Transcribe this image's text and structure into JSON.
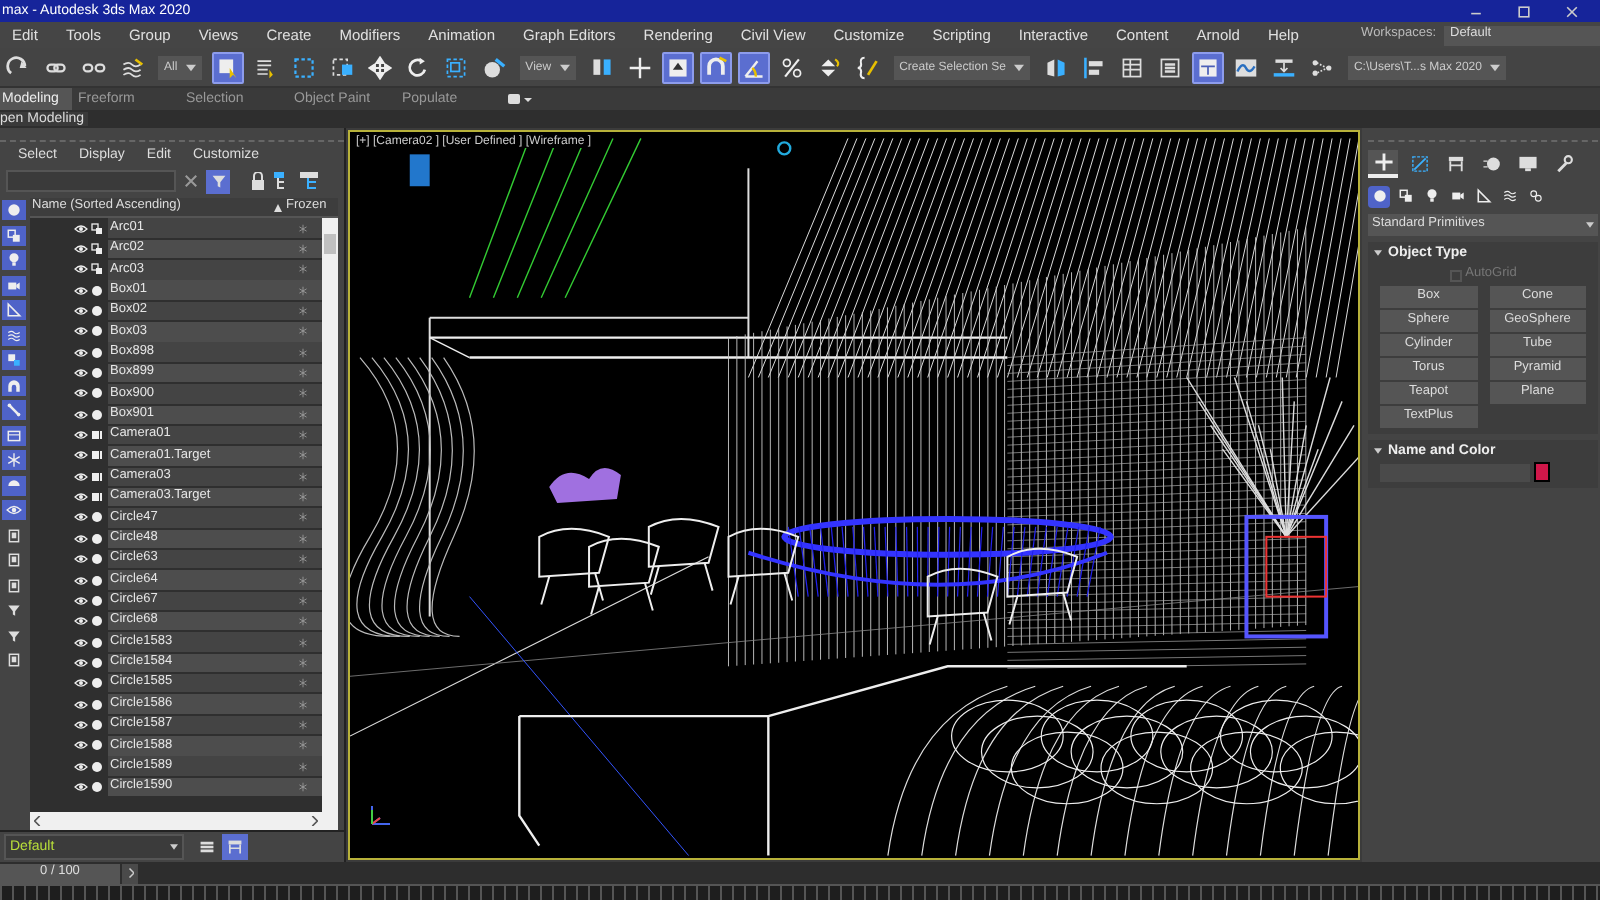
{
  "title_bar": {
    "title": "max - Autodesk 3ds Max 2020"
  },
  "menu_bar": {
    "items": [
      "Edit",
      "Tools",
      "Group",
      "Views",
      "Create",
      "Modifiers",
      "Animation",
      "Graph Editors",
      "Rendering",
      "Civil View",
      "Customize",
      "Scripting",
      "Interactive",
      "Content",
      "Arnold",
      "Help"
    ],
    "workspaces_label": "Workspaces:",
    "workspace": "Default"
  },
  "main_toolbar": {
    "items": [
      {
        "kind": "redo",
        "selected": false
      },
      {
        "kind": "link",
        "selected": false
      },
      {
        "kind": "unlink",
        "selected": false
      },
      {
        "kind": "bind",
        "selected": false
      },
      {
        "kind": "dropdown",
        "value": "All"
      },
      {
        "kind": "cursor",
        "selected": true
      },
      {
        "kind": "list",
        "selected": false
      },
      {
        "kind": "region",
        "selected": false
      },
      {
        "kind": "crossing",
        "selected": false
      },
      {
        "kind": "move",
        "selected": false
      },
      {
        "kind": "rotate",
        "selected": false
      },
      {
        "kind": "scale",
        "selected": false
      },
      {
        "kind": "placement",
        "selected": false
      },
      {
        "kind": "dropdown",
        "value": "View"
      },
      {
        "kind": "pivot",
        "selected": false
      },
      {
        "kind": "crosshair",
        "selected": false
      },
      {
        "kind": "keyboard",
        "selected": true
      },
      {
        "kind": "snap",
        "selected": true
      },
      {
        "kind": "angle",
        "selected": true
      },
      {
        "kind": "percent",
        "selected": false
      },
      {
        "kind": "spinner",
        "selected": false
      },
      {
        "kind": "braces",
        "selected": false
      },
      {
        "kind": "dropdown",
        "value": "Create Selection Se"
      },
      {
        "kind": "mirror",
        "selected": false
      },
      {
        "kind": "align",
        "selected": false
      },
      {
        "kind": "table",
        "selected": false
      },
      {
        "kind": "layers",
        "selected": false
      },
      {
        "kind": "ribbon",
        "selected": true
      },
      {
        "kind": "curve",
        "selected": false
      },
      {
        "kind": "schematic",
        "selected": false
      },
      {
        "kind": "nodes",
        "selected": false
      },
      {
        "kind": "dropdown",
        "value": "C:\\Users\\T...s Max 2020"
      }
    ]
  },
  "ribbon": {
    "tabs": [
      {
        "label": "Modeling",
        "selected": true
      },
      {
        "label": "Freeform",
        "selected": false
      },
      {
        "label": "Selection",
        "selected": false
      },
      {
        "label": "Object Paint",
        "selected": false
      },
      {
        "label": "Populate",
        "selected": false
      }
    ],
    "panel_label": "pen Modeling"
  },
  "scene_explorer": {
    "menu": [
      "Select",
      "Display",
      "Edit",
      "Customize"
    ],
    "filters": [
      {
        "kind": "geometry",
        "selected": true
      },
      {
        "kind": "shapes",
        "selected": true
      },
      {
        "kind": "lights",
        "selected": true
      },
      {
        "kind": "cameras",
        "selected": true
      },
      {
        "kind": "helpers",
        "selected": true
      },
      {
        "kind": "spacewarps",
        "selected": true
      },
      {
        "kind": "groups",
        "selected": true
      },
      {
        "kind": "xrefs",
        "selected": true
      },
      {
        "kind": "bones",
        "selected": true
      },
      {
        "kind": "containers",
        "selected": true
      },
      {
        "kind": "frozen",
        "selected": true
      },
      {
        "kind": "hidden",
        "selected": true
      },
      {
        "kind": "visible",
        "selected": true
      },
      {
        "kind": "page",
        "selected": false
      },
      {
        "kind": "page",
        "selected": false
      },
      {
        "kind": "page",
        "selected": false
      },
      {
        "kind": "filter",
        "selected": false
      },
      {
        "kind": "filter",
        "selected": false
      },
      {
        "kind": "page",
        "selected": false
      }
    ],
    "columns": [
      "Name (Sorted Ascending)",
      "Frozen"
    ],
    "rows": [
      {
        "name": "Arc01",
        "kind": "shape"
      },
      {
        "name": "Arc02",
        "kind": "shape"
      },
      {
        "name": "Arc03",
        "kind": "shape"
      },
      {
        "name": "Box01",
        "kind": "geometry"
      },
      {
        "name": "Box02",
        "kind": "geometry"
      },
      {
        "name": "Box03",
        "kind": "geometry"
      },
      {
        "name": "Box898",
        "kind": "geometry"
      },
      {
        "name": "Box899",
        "kind": "geometry"
      },
      {
        "name": "Box900",
        "kind": "geometry"
      },
      {
        "name": "Box901",
        "kind": "geometry"
      },
      {
        "name": "Camera01",
        "kind": "camera"
      },
      {
        "name": "Camera01.Target",
        "kind": "camera"
      },
      {
        "name": "Camera03",
        "kind": "camera"
      },
      {
        "name": "Camera03.Target",
        "kind": "camera"
      },
      {
        "name": "Circle47",
        "kind": "geometry"
      },
      {
        "name": "Circle48",
        "kind": "geometry"
      },
      {
        "name": "Circle63",
        "kind": "geometry"
      },
      {
        "name": "Circle64",
        "kind": "geometry"
      },
      {
        "name": "Circle67",
        "kind": "geometry"
      },
      {
        "name": "Circle68",
        "kind": "geometry"
      },
      {
        "name": "Circle1583",
        "kind": "geometry"
      },
      {
        "name": "Circle1584",
        "kind": "geometry"
      },
      {
        "name": "Circle1585",
        "kind": "geometry"
      },
      {
        "name": "Circle1586",
        "kind": "geometry"
      },
      {
        "name": "Circle1587",
        "kind": "geometry"
      },
      {
        "name": "Circle1588",
        "kind": "geometry"
      },
      {
        "name": "Circle1589",
        "kind": "geometry"
      },
      {
        "name": "Circle1590",
        "kind": "geometry"
      }
    ],
    "layer": "Default"
  },
  "viewport": {
    "label": "[+] [Camera02 ] [User Defined ] [Wireframe ]"
  },
  "command_panel": {
    "tabs": [
      {
        "kind": "create",
        "selected": true
      },
      {
        "kind": "modify",
        "selected": false
      },
      {
        "kind": "hierarchy",
        "selected": false
      },
      {
        "kind": "motion",
        "selected": false
      },
      {
        "kind": "display",
        "selected": false
      },
      {
        "kind": "utilities",
        "selected": false
      }
    ],
    "categories": [
      {
        "kind": "geometry",
        "selected": true
      },
      {
        "kind": "shapes",
        "selected": false
      },
      {
        "kind": "lights",
        "selected": false
      },
      {
        "kind": "cameras",
        "selected": false
      },
      {
        "kind": "helpers",
        "selected": false
      },
      {
        "kind": "spacewarps",
        "selected": false
      },
      {
        "kind": "systems",
        "selected": false
      }
    ],
    "category": "Standard Primitives",
    "object_type": {
      "title": "Object Type",
      "autogrid": {
        "label": "AutoGrid",
        "checked": false,
        "disabled": true
      },
      "buttons": [
        "Box",
        "Cone",
        "Sphere",
        "GeoSphere",
        "Cylinder",
        "Tube",
        "Torus",
        "Pyramid",
        "Teapot",
        "Plane",
        "TextPlus"
      ]
    },
    "name_and_color": {
      "title": "Name and Color",
      "color": "#d0174a"
    }
  },
  "time_slider": {
    "frame": "0 / 100",
    "level": 0
  }
}
